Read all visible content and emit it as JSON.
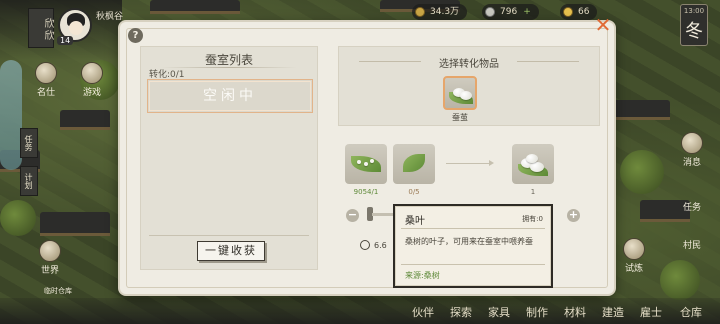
{
  "hud": {
    "status_flag": "欣欣",
    "avatar_level": "14",
    "player_name": "秋枫谷",
    "resources": [
      {
        "name": "copper",
        "value": "34.3万"
      },
      {
        "name": "silver",
        "value": "796"
      },
      {
        "name": "gold",
        "value": "66"
      }
    ],
    "season": {
      "time": "13:00",
      "label": "冬"
    }
  },
  "left_side": {
    "top_icons": [
      {
        "label": "名仕"
      },
      {
        "label": "游戏"
      }
    ],
    "tabs": [
      "任务",
      "计划"
    ],
    "bottom_icons": [
      {
        "label": "世界"
      },
      {
        "label": "临时仓库"
      }
    ]
  },
  "right_side": {
    "icons": [
      {
        "label": "消息"
      },
      {
        "label": "任务"
      },
      {
        "label": "村民"
      },
      {
        "label": "试炼"
      }
    ]
  },
  "bottom_menu": [
    "伙伴",
    "探索",
    "家具",
    "制作",
    "材料",
    "建造",
    "雇士",
    "仓库"
  ],
  "dialog": {
    "help_icon": "question-icon",
    "close_icon": "close-icon",
    "left_panel": {
      "title": "蚕室列表",
      "convert_count": "转化:0/1",
      "slot_status": "空闲中",
      "collect_button": "一键收获"
    },
    "right_panel": {
      "title": "选择转化物品",
      "selected_item": {
        "label": "蚕茧",
        "icon": "cocoon-icon"
      }
    },
    "recipe": {
      "inputs": [
        {
          "icon": "silkworm-icon",
          "qty": "9054/1"
        },
        {
          "icon": "mulberry-leaf-icon",
          "qty": "0/5"
        }
      ],
      "output": {
        "icon": "cocoon-icon",
        "qty": "1"
      }
    },
    "stepper": {
      "minus": "−",
      "plus": "+",
      "value": 0
    },
    "duration_text": "6.6"
  },
  "tooltip": {
    "name": "桑叶",
    "owned": "拥有:0",
    "description": "桑树的叶子，可用来在蚕室中喂养蚕",
    "source": "来源:桑树"
  }
}
